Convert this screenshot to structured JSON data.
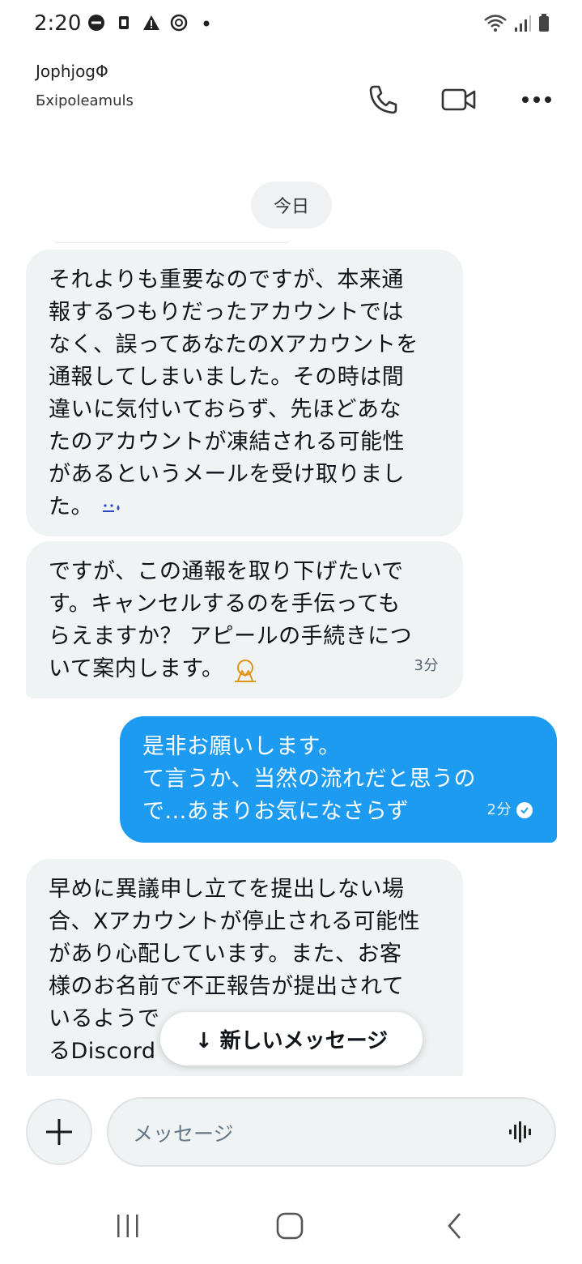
{
  "status_bar": {
    "time": "2:20"
  },
  "header": {
    "contact_name": "JophjogΦ",
    "contact_handle": "Бxipoleamuls"
  },
  "chat": {
    "date_label": "今日",
    "messages": [
      {
        "direction": "incoming",
        "lines": [
          "それよりも重要なのですが、本来通",
          "報するつもりだったアカウントでは",
          "なく、誤ってあなたのXアカウントを",
          "通報してしまいました。その時は間",
          "違いに気付いておらず、先ほどあな",
          "たのアカウントが凍結される可能性",
          "があるというメールを受け取りまし",
          "た。"
        ],
        "emoji": "😓"
      },
      {
        "direction": "incoming",
        "lines": [
          "ですが、この通報を取り下げたいで",
          "す。キャンセルするのを手伝っても",
          "らえますか？ アピールの手続きにつ",
          "いて案内します。"
        ],
        "emoji": "🙏",
        "time": "3分"
      },
      {
        "direction": "outgoing",
        "lines": [
          "是非お願いします。",
          "て言うか、当然の流れだと思うの",
          "で...あまりお気になさらず"
        ],
        "time": "2分"
      },
      {
        "direction": "incoming",
        "lines": [
          "早めに異議申し立てを提出しない場",
          "合、Xアカウントが停止される可能性",
          "があり心配しています。また、お客",
          "様のお名前で不正報告が提出されて",
          "いるようで",
          "るDiscord"
        ]
      }
    ],
    "new_messages_label": "↓ 新しいメッセージ"
  },
  "composer": {
    "placeholder": "メッセージ"
  },
  "colors": {
    "outgoing_bubble": "#1d9bf0",
    "incoming_bubble": "#eff3f4"
  }
}
